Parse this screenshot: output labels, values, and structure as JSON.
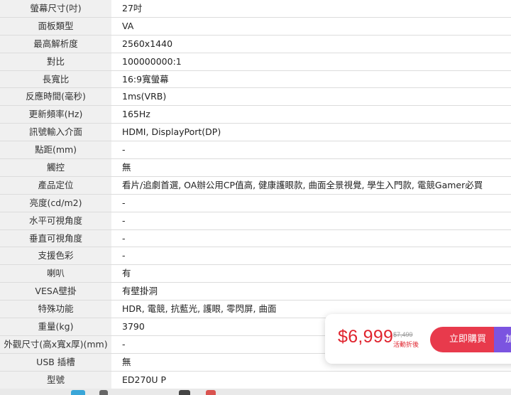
{
  "specs": [
    {
      "label": "螢幕尺寸(吋)",
      "value": "27吋"
    },
    {
      "label": "面板類型",
      "value": "VA"
    },
    {
      "label": "最高解析度",
      "value": "2560x1440"
    },
    {
      "label": "對比",
      "value": "100000000:1"
    },
    {
      "label": "長寬比",
      "value": "16:9寬螢幕"
    },
    {
      "label": "反應時間(毫秒)",
      "value": "1ms(VRB)"
    },
    {
      "label": "更新頻率(Hz)",
      "value": "165Hz"
    },
    {
      "label": "訊號輸入介面",
      "value": "HDMI, DisplayPort(DP)"
    },
    {
      "label": "點距(mm)",
      "value": "-"
    },
    {
      "label": "觸控",
      "value": "無"
    },
    {
      "label": "產品定位",
      "value": "看片/追劇首選, OA辦公用CP值高, 健康護眼款, 曲面全景視覺, 學生入門款, 電競Gamer必買"
    },
    {
      "label": "亮度(cd/m2)",
      "value": "-"
    },
    {
      "label": "水平可視角度",
      "value": "-"
    },
    {
      "label": "垂直可視角度",
      "value": "-"
    },
    {
      "label": "支援色彩",
      "value": "-"
    },
    {
      "label": "喇叭",
      "value": "有"
    },
    {
      "label": "VESA壁掛",
      "value": "有壁掛洞"
    },
    {
      "label": "特殊功能",
      "value": "HDR, 電競, 抗藍光, 護眼, 零閃屏, 曲面"
    },
    {
      "label": "重量(kg)",
      "value": "3790"
    },
    {
      "label": "外觀尺寸(高x寬x厚)(mm)",
      "value": "-"
    },
    {
      "label": "USB 插槽",
      "value": "無"
    },
    {
      "label": "型號",
      "value": "ED270U P"
    }
  ],
  "purchase": {
    "price": "$6,999",
    "original_price": "$7,499",
    "promo_label": "活動折後",
    "buy_label": "立即購買",
    "cart_label": "加入購物車"
  },
  "colors": {
    "price": "#e0242e",
    "buy_button": "#e83a4c",
    "cart_button": "#7b54e0",
    "label_bg": "#f0f0f0"
  }
}
